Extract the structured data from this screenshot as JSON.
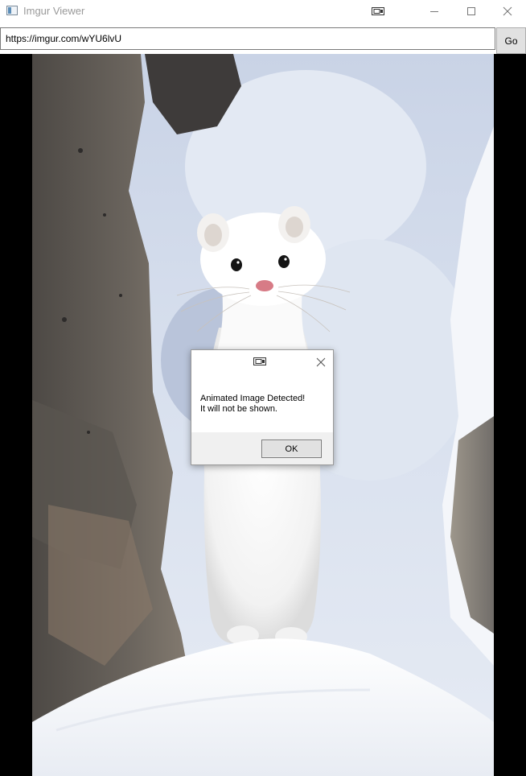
{
  "window": {
    "title": "Imgur Viewer",
    "icons": {
      "app": "app-window-icon",
      "tablet_mode": "tablet-mode-icon",
      "minimize": "minimize-icon",
      "maximize": "maximize-icon",
      "close": "close-icon"
    }
  },
  "address_bar": {
    "url": "https://imgur.com/wYU6lvU",
    "go_label": "Go"
  },
  "viewer": {
    "image_subject": "white ermine standing in snow between rocks"
  },
  "dialog": {
    "message_line1": "Animated Image Detected!",
    "message_line2": "It will not be shown.",
    "ok_label": "OK",
    "icons": {
      "title": "tablet-mode-icon",
      "close": "close-icon"
    }
  },
  "colors": {
    "titlebar_text": "#9a9a9a",
    "viewport_background": "#000000",
    "button_face": "#e1e1e1",
    "dialog_footer": "#f0f0f0"
  }
}
